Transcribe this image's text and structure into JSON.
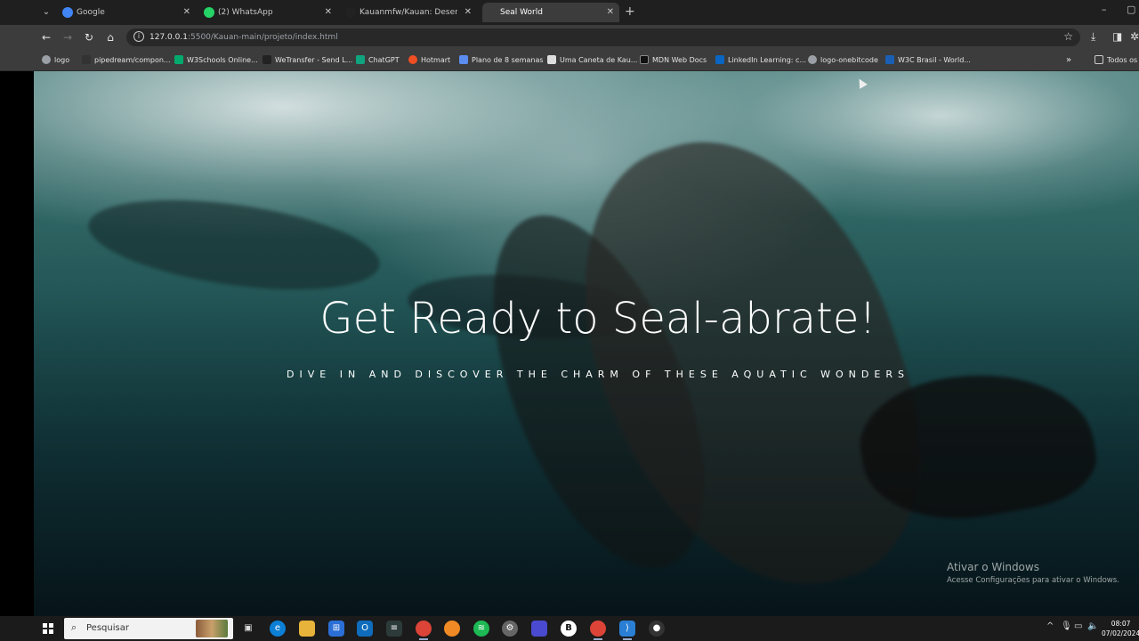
{
  "browser": {
    "tabs": [
      {
        "title": "Google",
        "favicon_color": "#4285f4",
        "active": false
      },
      {
        "title": "(2) WhatsApp",
        "favicon_color": "#25d366",
        "active": false
      },
      {
        "title": "Kauanmfw/Kauan: Desenvolver...",
        "favicon_color": "#222222",
        "active": false
      },
      {
        "title": "Seal World",
        "favicon_color": "#3c3c3c",
        "active": true
      }
    ],
    "url_host": "127.0.0.1",
    "url_rest": ":5500/Kauan-main/projeto/index.html",
    "bookmarks": [
      {
        "label": "logo",
        "color": "#9aa0a6"
      },
      {
        "label": "pipedream/compon...",
        "color": "#333333"
      },
      {
        "label": "W3Schools Online...",
        "color": "#04aa6d"
      },
      {
        "label": "WeTransfer - Send L...",
        "color": "#222222"
      },
      {
        "label": "ChatGPT",
        "color": "#10a37f"
      },
      {
        "label": "Hotmart",
        "color": "#f04e23"
      },
      {
        "label": "Plano de 8 semanas",
        "color": "#5b8def"
      },
      {
        "label": "Uma Caneta de Kau...",
        "color": "#dddddd"
      },
      {
        "label": "MDN Web Docs",
        "color": "#111111"
      },
      {
        "label": "LinkedIn Learning: c...",
        "color": "#0a66c2"
      },
      {
        "label": "logo-onebitcode",
        "color": "#9aa0a6"
      },
      {
        "label": "W3C Brasil - World...",
        "color": "#1a5fb4"
      }
    ],
    "all_bookmarks": "Todos os f"
  },
  "hero": {
    "title": "Get Ready to Seal-abrate!",
    "subtitle": "DIVE IN AND DISCOVER THE CHARM OF THESE AQUATIC WONDERS"
  },
  "watermark": {
    "line1": "Ativar o Windows",
    "line2": "Acesse Configurações para ativar o Windows."
  },
  "taskbar": {
    "search_label": "Pesquisar",
    "time": "08:07",
    "date": "07/02/2024"
  }
}
